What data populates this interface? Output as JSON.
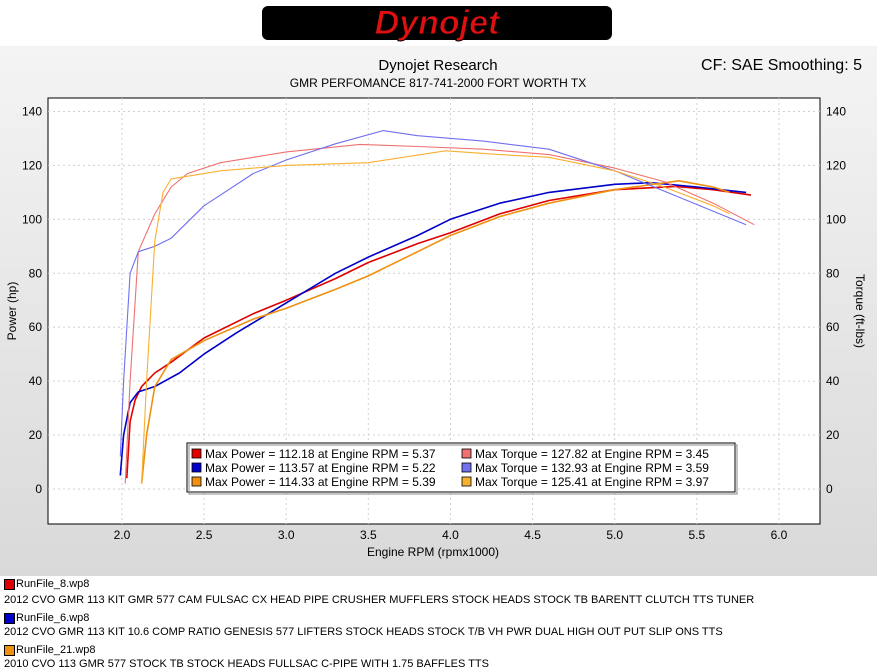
{
  "logo": {
    "text": "Dynojet"
  },
  "chart_data": {
    "type": "line",
    "title": "Dynojet Research",
    "subtitle": "GMR PERFOMANCE 817-741-2000  FORT WORTH TX",
    "correction": "CF: SAE Smoothing: 5",
    "xlabel": "Engine RPM (rpmx1000)",
    "ylabel": "Power (hp)",
    "y2label": "Torque (ft-lbs)",
    "xlim": [
      1.55,
      6.25
    ],
    "ylim": [
      -13,
      145
    ],
    "xticks": [
      "2.0",
      "2.5",
      "3.0",
      "3.5",
      "4.0",
      "4.5",
      "5.0",
      "5.5",
      "6.0"
    ],
    "yticks": [
      "0",
      "20",
      "40",
      "60",
      "80",
      "100",
      "120",
      "140"
    ],
    "grid": true,
    "legend_position": "bottom-center",
    "legend": [
      {
        "text": "Max Power = 112.18 at Engine RPM = 5.37",
        "color": "#e00000"
      },
      {
        "text": "Max Power = 113.57 at Engine RPM = 5.22",
        "color": "#0000c8"
      },
      {
        "text": "Max Power = 114.33 at Engine RPM = 5.39",
        "color": "#f09010"
      },
      {
        "text": "Max Torque = 127.82 at Engine RPM = 3.45",
        "color": "#f07070"
      },
      {
        "text": "Max Torque = 132.93 at Engine RPM = 3.59",
        "color": "#7070f0"
      },
      {
        "text": "Max Torque = 125.41 at Engine RPM = 3.97",
        "color": "#f8b030"
      }
    ],
    "series": [
      {
        "file": "RunFile_8.wp8",
        "kind": "power",
        "color": "#e00000",
        "x": [
          2.03,
          2.05,
          2.08,
          2.12,
          2.2,
          2.3,
          2.5,
          2.8,
          3.0,
          3.3,
          3.5,
          3.8,
          4.0,
          4.3,
          4.6,
          5.0,
          5.37,
          5.6,
          5.83
        ],
        "y": [
          4,
          25,
          33,
          38,
          43,
          47,
          56,
          65,
          70,
          78,
          84,
          91,
          95,
          102,
          107,
          111,
          112.2,
          111,
          109
        ]
      },
      {
        "file": "RunFile_6.wp8",
        "kind": "power",
        "color": "#0000c8",
        "x": [
          1.99,
          2.01,
          2.05,
          2.1,
          2.2,
          2.35,
          2.5,
          2.7,
          3.0,
          3.3,
          3.5,
          3.8,
          4.0,
          4.3,
          4.6,
          5.0,
          5.22,
          5.5,
          5.8
        ],
        "y": [
          5,
          20,
          32,
          36,
          38,
          43,
          50,
          58,
          69,
          80,
          86,
          94,
          100,
          106,
          110,
          113,
          113.6,
          112,
          110
        ]
      },
      {
        "file": "RunFile_21.wp8",
        "kind": "power",
        "color": "#f09010",
        "x": [
          2.12,
          2.15,
          2.2,
          2.3,
          2.5,
          2.8,
          3.0,
          3.3,
          3.5,
          3.8,
          4.0,
          4.3,
          4.6,
          5.0,
          5.39,
          5.6,
          5.7
        ],
        "y": [
          2,
          20,
          38,
          48,
          55,
          63,
          67,
          74,
          79,
          88,
          94,
          101,
          106,
          111,
          114.3,
          112,
          110
        ]
      },
      {
        "file": "RunFile_8.wp8",
        "kind": "torque",
        "color": "#f07070",
        "x": [
          2.02,
          2.05,
          2.1,
          2.2,
          2.3,
          2.4,
          2.6,
          3.0,
          3.45,
          3.8,
          4.2,
          4.6,
          5.0,
          5.3,
          5.6,
          5.85
        ],
        "y": [
          2,
          40,
          88,
          102,
          112,
          117,
          121,
          125,
          127.8,
          127,
          126,
          124,
          119,
          114,
          106,
          98
        ]
      },
      {
        "file": "RunFile_6.wp8",
        "kind": "torque",
        "color": "#7070f0",
        "x": [
          1.99,
          2.01,
          2.05,
          2.1,
          2.2,
          2.3,
          2.5,
          2.8,
          3.0,
          3.3,
          3.59,
          3.8,
          4.2,
          4.6,
          5.0,
          5.4,
          5.8
        ],
        "y": [
          12,
          40,
          80,
          88,
          90,
          93,
          105,
          117,
          122,
          128,
          132.9,
          131,
          129,
          126,
          118,
          108,
          98
        ]
      },
      {
        "file": "RunFile_21.wp8",
        "kind": "torque",
        "color": "#f8b030",
        "x": [
          2.12,
          2.15,
          2.2,
          2.25,
          2.3,
          2.4,
          2.6,
          3.0,
          3.5,
          3.97,
          4.3,
          4.6,
          5.0,
          5.3,
          5.6,
          5.7
        ],
        "y": [
          2,
          40,
          92,
          110,
          115,
          116,
          118,
          120,
          121,
          125.4,
          124,
          123,
          118,
          112,
          105,
          102
        ]
      }
    ]
  },
  "runs": [
    {
      "name": "RunFile_8.wp8",
      "color": "#e00000",
      "desc": "2012  CVO  GMR  113  KIT  GMR  577  CAM  FULSAC  CX  HEAD  PIPE  CRUSHER  MUFFLERS  STOCK  HEADS  STOCK  TB  BARENTT  CLUTCH  TTS  TUNER"
    },
    {
      "name": "RunFile_6.wp8",
      "color": "#0000c8",
      "desc": "2012  CVO  GMR  113  KIT   10.6  COMP  RATIO  GENESIS  577  LIFTERS  STOCK  HEADS  STOCK  T/B  VH  PWR  DUAL  HIGH  OUT  PUT  SLIP  ONS  TTS"
    },
    {
      "name": "RunFile_21.wp8",
      "color": "#f09010",
      "desc": "2010  CVO  113  GMR  577  STOCK  TB  STOCK  HEADS  FULLSAC  C-PIPE  WITH  1.75  BAFFLES  TTS"
    }
  ]
}
